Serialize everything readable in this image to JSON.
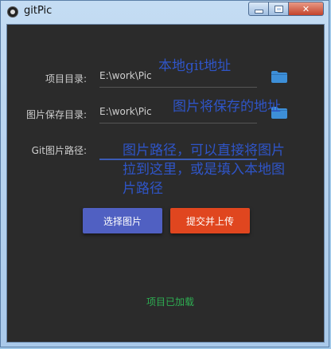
{
  "window": {
    "title": "gitPic",
    "controls": {
      "minimize": "minimize",
      "maximize": "maximize",
      "close": "✕"
    }
  },
  "form": {
    "project_dir": {
      "label": "项目目录:",
      "value": "E:\\work\\Pic",
      "hint": "本地git地址"
    },
    "save_dir": {
      "label": "图片保存目录:",
      "value": "E:\\work\\Pic",
      "hint": "图片将保存的地址"
    },
    "git_path": {
      "label": "Git图片路径:",
      "value": "",
      "hint": "图片路径，可以直接将图片\n拉到这里，或是填入本地图\n片路径"
    }
  },
  "buttons": {
    "select_image": "选择图片",
    "submit_upload": "提交并上传"
  },
  "status": {
    "text": "项目已加载"
  },
  "colors": {
    "background": "#2b2b2b",
    "primary_button": "#5060c2",
    "accent_button": "#e0461f",
    "folder_icon": "#3d8fd8",
    "hint_text": "#2f55c8",
    "status_text": "#2eae52"
  },
  "icons": {
    "folder": "folder-icon",
    "app": "app-icon"
  }
}
